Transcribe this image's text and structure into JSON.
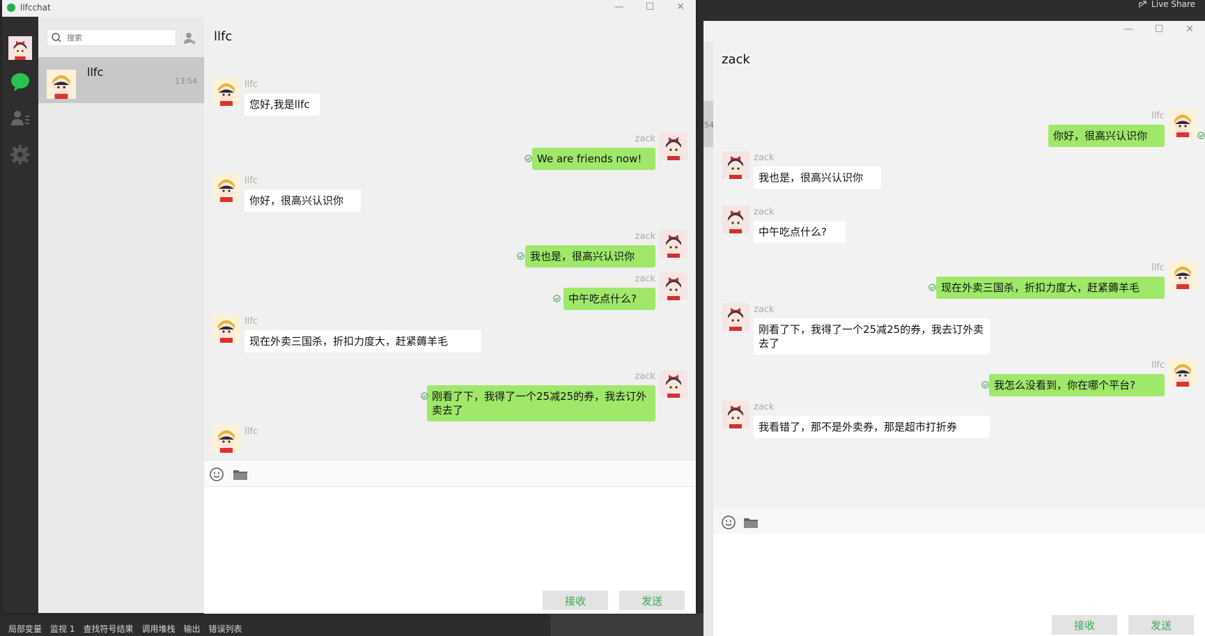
{
  "ide": {
    "live_share": "Live Share",
    "bottom_tabs": [
      "局部变量",
      "监视 1",
      "查找符号结果",
      "调用堆栈",
      "输出",
      "错误列表"
    ]
  },
  "left": {
    "app_title": "llfcchat",
    "search_placeholder": "搜索",
    "contact": {
      "name": "llfc",
      "time": "13:54"
    },
    "chat_title": "llfc",
    "btn_receive": "接收",
    "btn_send": "发送",
    "messages": [
      {
        "dir": "in",
        "sender": "llfc",
        "text": "您好,我是llfc"
      },
      {
        "dir": "out",
        "sender": "zack",
        "text": "We are friends now!"
      },
      {
        "dir": "in",
        "sender": "llfc",
        "text": "你好，很高兴认识你"
      },
      {
        "dir": "out",
        "sender": "zack",
        "text": "我也是，很高兴认识你"
      },
      {
        "dir": "out",
        "sender": "zack",
        "text": "中午吃点什么?"
      },
      {
        "dir": "in",
        "sender": "llfc",
        "text": "现在外卖三国杀，折扣力度大，赶紧薅羊毛"
      },
      {
        "dir": "out",
        "sender": "zack",
        "text": "刚看了下，我得了一个25减25的券，我去订外卖去了"
      },
      {
        "dir": "in",
        "sender": "llfc",
        "text": ""
      }
    ]
  },
  "right": {
    "chat_title": "zack",
    "partial_time": "54",
    "btn_receive": "接收",
    "btn_send": "发送",
    "messages": [
      {
        "dir": "out",
        "sender": "llfc",
        "text": "你好，很高兴认识你"
      },
      {
        "dir": "in",
        "sender": "zack",
        "text": "我也是，很高兴认识你"
      },
      {
        "dir": "in",
        "sender": "zack",
        "text": "中午吃点什么?"
      },
      {
        "dir": "out",
        "sender": "llfc",
        "text": "现在外卖三国杀，折扣力度大，赶紧薅羊毛"
      },
      {
        "dir": "in",
        "sender": "zack",
        "text": "刚看了下，我得了一个25减25的券，我去订外卖去了"
      },
      {
        "dir": "out",
        "sender": "llfc",
        "text": "我怎么没看到，你在哪个平台?"
      },
      {
        "dir": "in",
        "sender": "zack",
        "text": "我看错了，那不是外卖券，那是超市打折券"
      }
    ]
  },
  "colors": {
    "bubble_out": "#9fe86a",
    "bubble_in": "#ffffff",
    "accent": "#3fa652",
    "sidebar": "#2e2e2e"
  }
}
